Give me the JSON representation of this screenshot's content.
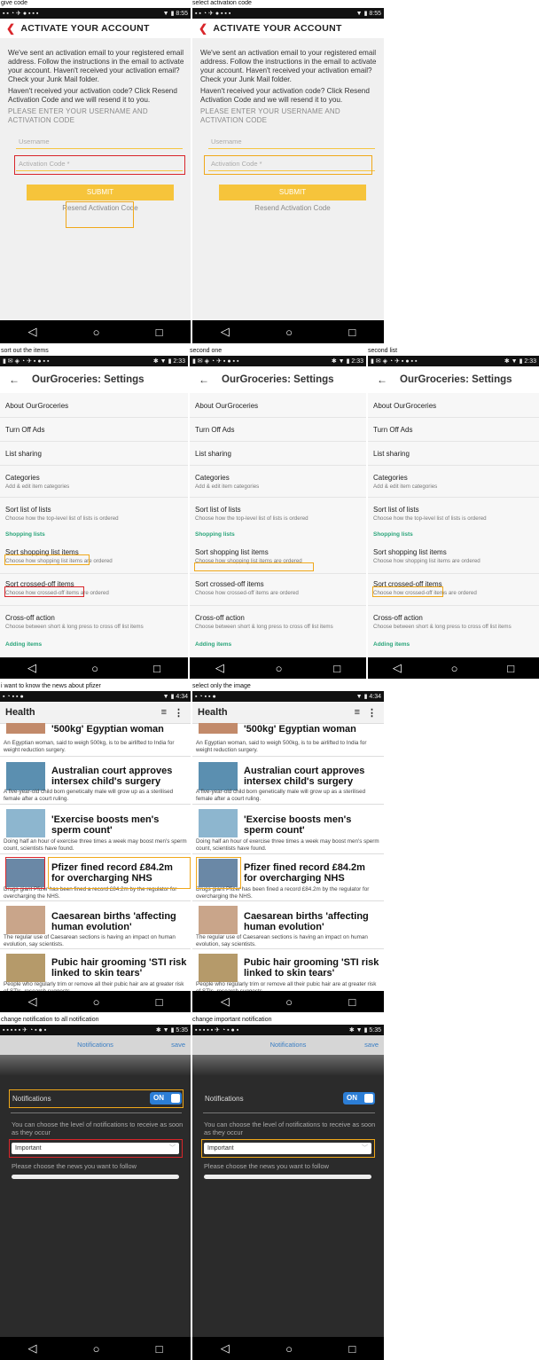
{
  "captions": {
    "act1": "give code",
    "act2": "select activation code",
    "set1": "sort out the items",
    "set2": "second one",
    "set3": "second list",
    "hlt1": "i want to know the news about pfizer",
    "hlt2": "select only the image",
    "ntf1": "change notification to all notification",
    "ntf2": "change important notification"
  },
  "status": {
    "time_act": "8:55",
    "time_set": "2:33",
    "time_hlt": "4:34",
    "time_ntf": "5:35"
  },
  "activate": {
    "title": "ACTIVATE YOUR ACCOUNT",
    "para1": "We've sent an activation email to your registered email address. Follow the instructions in the email to activate your account. Haven't received your activation email? Check your Junk Mail folder.",
    "para2": "Haven't received your activation code? Click Resend Activation Code and we will resend it to you.",
    "enter": "PLEASE ENTER YOUR USERNAME AND ACTIVATION CODE",
    "username_placeholder": "Username",
    "code_placeholder": "Activation Code *",
    "submit": "SUBMIT",
    "resend": "Resend Activation Code"
  },
  "settings": {
    "title": "OurGroceries: Settings",
    "about": "About OurGroceries",
    "ads": "Turn Off Ads",
    "sharing": "List sharing",
    "categories": "Categories",
    "categories_sub": "Add & edit item categories",
    "sort_lists": "Sort list of lists",
    "sort_lists_sub": "Choose how the top-level list of lists is ordered",
    "shopping_section": "Shopping lists",
    "sort_shop": "Sort shopping list items",
    "sort_shop_sub": "Choose how shopping list items are ordered",
    "sort_cross": "Sort crossed-off items",
    "sort_cross_sub": "Choose how crossed-off items are ordered",
    "cross_action": "Cross-off action",
    "cross_action_sub": "Choose between short & long press to cross off list items",
    "adding_section": "Adding items"
  },
  "health": {
    "title": "Health",
    "n1_head": "'500kg' Egyptian woman",
    "n1_desc": "An Egyptian woman, said to weigh 500kg, is to be airlifted to India for weight reduction surgery.",
    "n2_head": "Australian court approves intersex child's surgery",
    "n2_desc": "A five-year-old child born genetically male will grow up as a sterilised female after a court ruling.",
    "n3_head": "'Exercise boosts men's sperm count'",
    "n3_desc": "Doing half an hour of exercise three times a week may boost men's sperm count, scientists have found.",
    "n4_head": "Pfizer fined record £84.2m for overcharging NHS",
    "n4_desc": "Drugs giant Pfizer has been fined a record £84.2m by the regulator for overcharging the NHS.",
    "n5_head": "Caesarean births 'affecting human evolution'",
    "n5_desc": "The regular use of Caesarean sections is having an impact on human evolution, say scientists.",
    "n6_head": "Pubic hair grooming 'STI risk linked to skin tears'",
    "n6_desc": "People who regularly trim or remove all their pubic hair are at greater risk of STIs, research suggests."
  },
  "notif": {
    "title": "Notifications",
    "save": "save",
    "label": "Notifications",
    "toggle": "ON",
    "level_text": "You can choose the level of notifications to receive as soon as they occur",
    "level_value": "Important",
    "follow_text": "Please choose the news you want to follow"
  },
  "colors": {
    "accent_yellow": "#f6c43b",
    "highlight_red": "#d9252a",
    "highlight_orange": "#f0a81a",
    "settings_green": "#2aa57a",
    "toggle_blue": "#2c7ed6"
  }
}
